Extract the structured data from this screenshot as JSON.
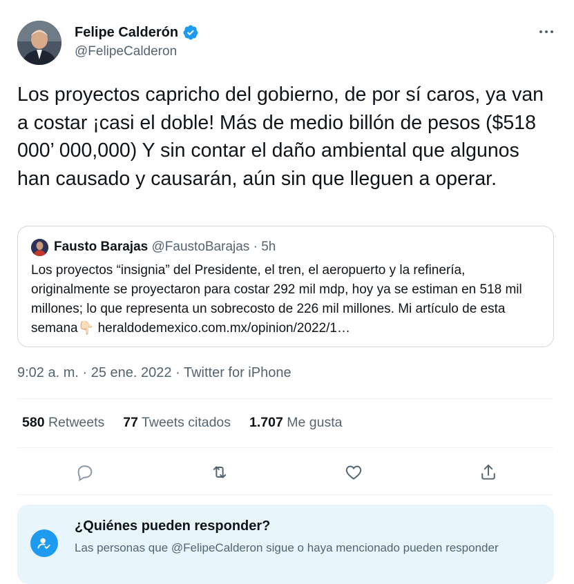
{
  "author": {
    "display_name": "Felipe Calderón",
    "handle": "@FelipeCalderon",
    "verified": true
  },
  "tweet": {
    "text": "Los proyectos capricho del gobierno, de por sí caros, ya van a costar ¡casi el doble! Más de medio billón de pesos ($518 000’ 000,000) Y sin contar el daño ambiental que algunos han causado y causarán, aún sin que lleguen a operar."
  },
  "quote": {
    "display_name": "Fausto Barajas",
    "handle": "@FaustoBarajas",
    "separator": "·",
    "time": "5h",
    "text": "Los proyectos “insignia” del Presidente, el tren, el aeropuerto y la refinería, originalmente se proyectaron para costar 292 mil mdp, hoy ya se estiman en 518 mil millones; lo que representa un sobrecosto de 226 mil millones. Mi artículo de esta semana",
    "emoji": "👇🏻",
    "link": "heraldodemexico.com.mx/opinion/2022/1…"
  },
  "meta": {
    "time": "9:02 a. m.",
    "dot": "·",
    "date": "25 ene. 2022",
    "source": "Twitter for iPhone"
  },
  "stats": {
    "retweets_count": "580",
    "retweets_label": "Retweets",
    "quotes_count": "77",
    "quotes_label": "Tweets citados",
    "likes_count": "1.707",
    "likes_label": "Me gusta"
  },
  "actions": [
    "reply-icon",
    "retweet-icon",
    "like-icon",
    "share-icon"
  ],
  "reply_restriction": {
    "title": "¿Quiénes pueden responder?",
    "description": "Las personas que @FelipeCalderon sigue o haya mencionado pueden responder"
  },
  "colors": {
    "accent": "#1d9bf0",
    "text_primary": "#0f1419",
    "text_secondary": "#536471",
    "border": "#cfd9de",
    "info_bg": "#e8f5fd"
  }
}
